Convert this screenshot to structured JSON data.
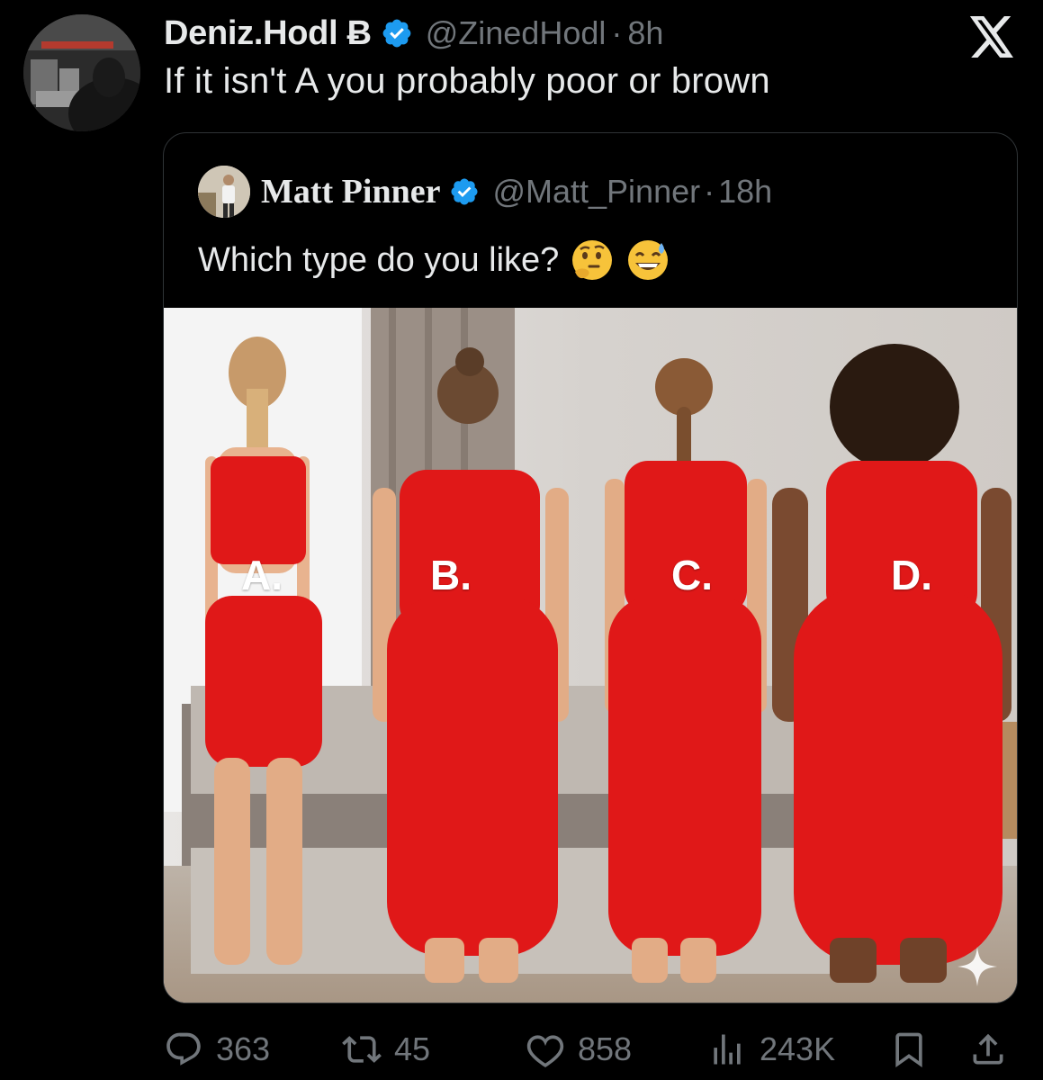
{
  "post": {
    "display_name": "Deniz.Hodl Ƀ",
    "handle": "@ZinedHodl",
    "separator": "·",
    "time": "8h",
    "text": "If it isn't A you probably poor or brown",
    "verified_color": "#1d9bf0"
  },
  "quote": {
    "display_name": "Matt Pinner",
    "handle": "@Matt_Pinner",
    "separator": "·",
    "time": "18h",
    "text": "Which type do you like?",
    "emojis": [
      "thinking-face-icon",
      "grinning-sweat-face-icon"
    ],
    "image_labels": [
      "A.",
      "B.",
      "C.",
      "D."
    ]
  },
  "actions": {
    "replies": "363",
    "reposts": "45",
    "likes": "858",
    "views": "243K"
  },
  "icons": {
    "brand": "x-logo-icon",
    "reply": "reply-icon",
    "repost": "repost-icon",
    "like": "heart-icon",
    "views": "views-icon",
    "bookmark": "bookmark-icon",
    "share": "share-icon"
  }
}
